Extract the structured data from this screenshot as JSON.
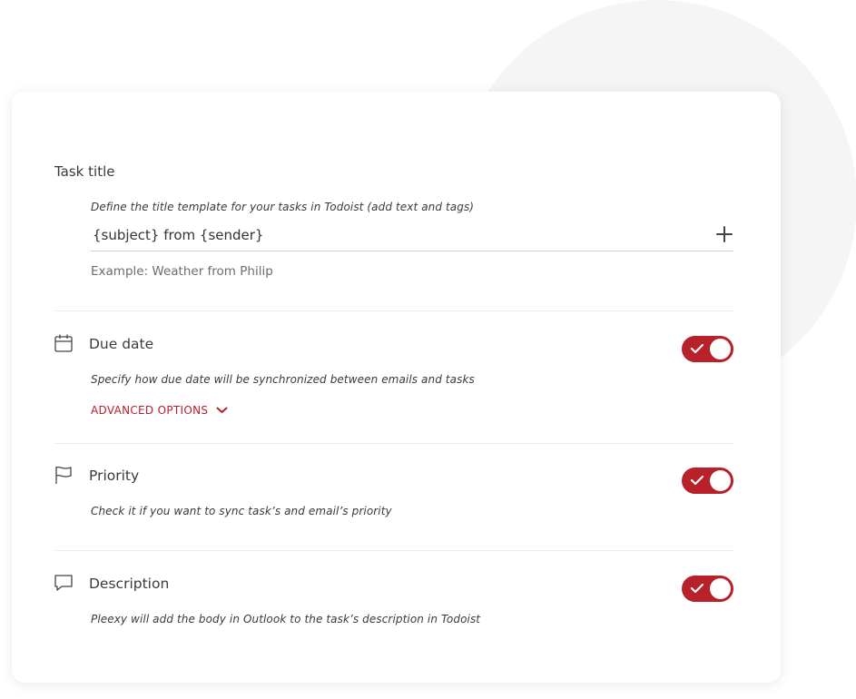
{
  "task_title": {
    "heading": "Task title",
    "help": "Define the title template for your tasks in Todoist (add text and tags)",
    "value": "{subject} from {sender}",
    "add_icon": "plus-icon",
    "example": "Example: Weather from Philip"
  },
  "due_date": {
    "icon": "calendar-icon",
    "title": "Due date",
    "help": "Specify how due date will be synchronized between emails and tasks",
    "advanced_label": "ADVANCED OPTIONS",
    "enabled": true
  },
  "priority": {
    "icon": "flag-icon",
    "title": "Priority",
    "help": "Check it if you want to sync task’s and email’s priority",
    "enabled": true
  },
  "description": {
    "icon": "comment-icon",
    "title": "Description",
    "help": "Pleexy will add the body in Outlook to the task’s description in Todoist",
    "enabled": true
  },
  "colors": {
    "accent": "#b8202a",
    "text": "#3a3a3a",
    "muted": "#6c6c72",
    "background_circle": "#f5f5f5"
  }
}
